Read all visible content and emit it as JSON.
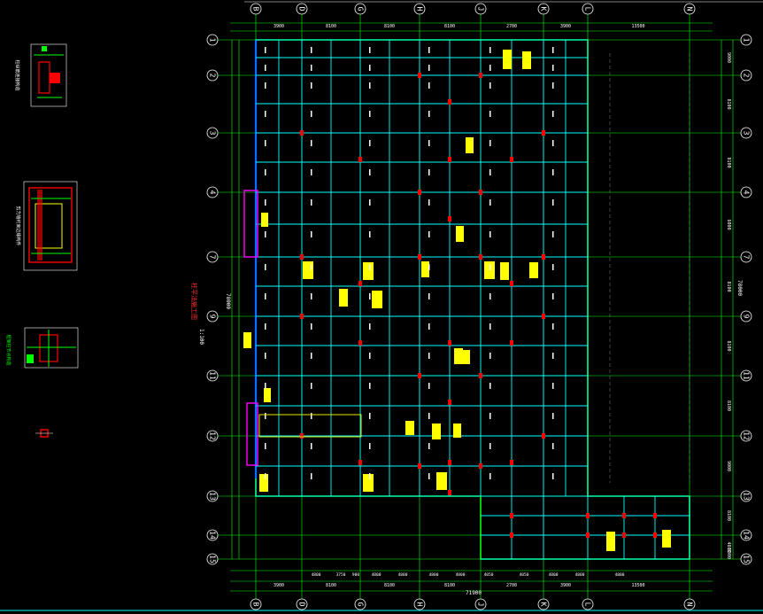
{
  "drawing": {
    "vertical_title": "柱平法施工图",
    "scale_text": "1:100",
    "left_dim_text": "78000",
    "right_dim_text": "78000"
  },
  "grid": {
    "col_labels": [
      "B",
      "D",
      "G",
      "H",
      "J",
      "K",
      "L",
      "N"
    ],
    "row_labels": [
      "1",
      "2",
      "3",
      "4",
      "7",
      "9",
      "11",
      "12",
      "13",
      "14",
      "15"
    ]
  },
  "dimensions": {
    "top": [
      "3900",
      "8100",
      "8100",
      "8100",
      "2700",
      "3900",
      "13500"
    ],
    "bottom_inner": [
      "4800",
      "3750",
      "900",
      "4800",
      "4800",
      "4800",
      "4800",
      "4050",
      "4050",
      "4800",
      "4800",
      "4800"
    ],
    "bottom_outer": [
      "3900",
      "8100",
      "8100",
      "8100",
      "2700",
      "3900",
      "13500"
    ],
    "bottom_total": "71900",
    "right": [
      "9000",
      "8100",
      "8100",
      "6000",
      "8100",
      "8100",
      "8100",
      "9000",
      "8100",
      "4800",
      "3300"
    ]
  },
  "details": {
    "detail1_title": "柱纵筋连接构造",
    "detail2_title": "剪力墙约束边缘构件",
    "detail3_title": "框架柱节点构造"
  },
  "colors": {
    "background": "#000000",
    "grid_line": "#00ff00",
    "beam": "#00ffff",
    "column": "#ff0000",
    "annotation": "#ffff00",
    "frame": "#ff00ff",
    "wall_blue": "#0000ff"
  }
}
